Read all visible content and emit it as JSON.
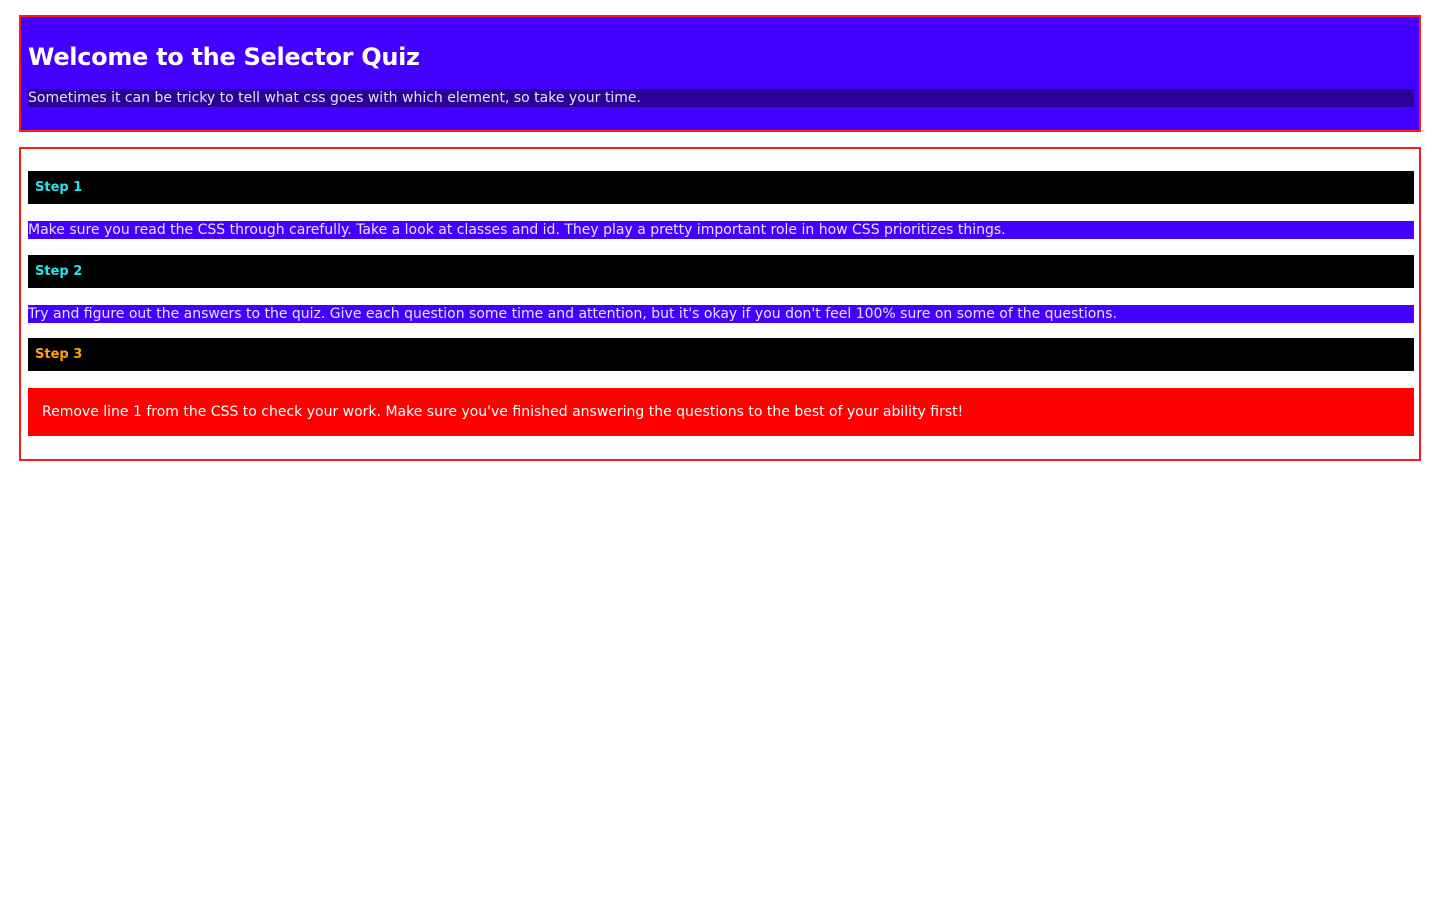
{
  "header": {
    "title": "Welcome to the Selector Quiz",
    "subtitle": "Sometimes it can be tricky to tell what css goes with which element, so take your time."
  },
  "steps": [
    {
      "heading": "Step 1",
      "text": "Make sure you read the CSS through carefully. Take a look at classes and id. They play a pretty important role in how CSS prioritizes things."
    },
    {
      "heading": "Step 2",
      "text": "Try and figure out the answers to the quiz. Give each question some time and attention, but it's okay if you don't feel 100% sure on some of the questions."
    },
    {
      "heading": "Step 3",
      "text": "Remove line 1 from the CSS to check your work. Make sure you've finished answering the questions to the best of your ability first!"
    }
  ],
  "colors": {
    "header_bg": "#4400ff",
    "border": "#ff1a1a",
    "step_bar_bg": "#000000",
    "step_heading_cyan": "#22e5ee",
    "step_heading_orange": "#ffa500",
    "alert_bg": "#ff0000"
  }
}
